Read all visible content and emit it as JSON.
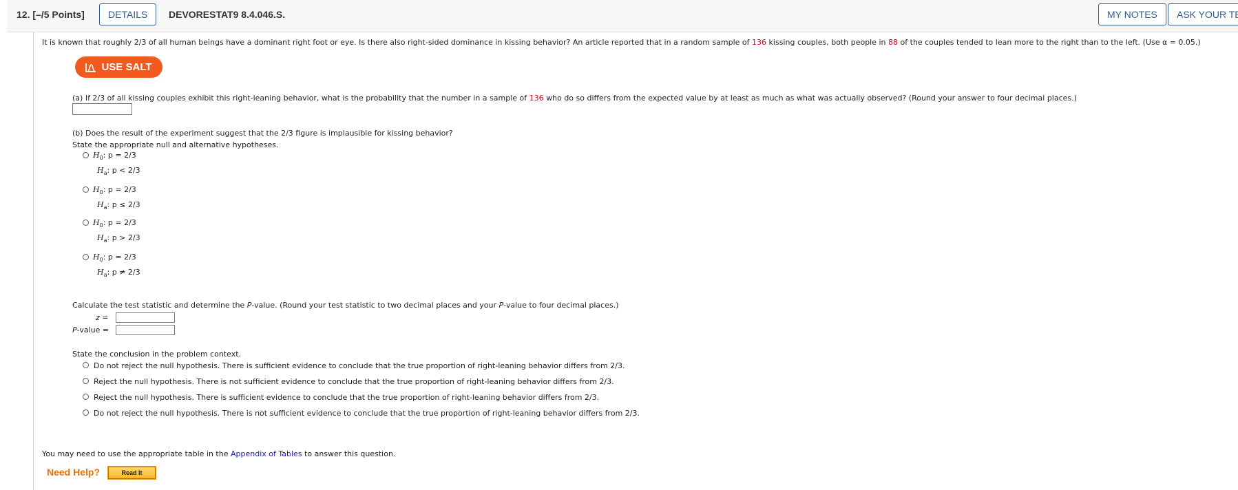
{
  "header": {
    "question_number": "12.",
    "points": "[–/5 Points]",
    "details_label": "DETAILS",
    "problem_code": "DEVORESTAT9 8.4.046.S.",
    "my_notes_label": "MY NOTES",
    "ask_teacher_label": "ASK YOUR TE"
  },
  "intro": {
    "part1": "It is known that roughly 2/3 of all human beings have a dominant right foot or eye. Is there also right-sided dominance in kissing behavior? An article reported that in a random sample of ",
    "n": "136",
    "part2": " kissing couples, both people in ",
    "x": "88",
    "part3": " of the couples tended to lean more to the right than to the left. (Use α = 0.05.)"
  },
  "salt_button": {
    "label": "USE SALT",
    "icon": "salt-chart-icon"
  },
  "part_a": {
    "part1": "(a) If 2/3 of all kissing couples exhibit this right-leaning behavior, what is the probability that the number in a sample of ",
    "n": "136",
    "part2": " who do so differs from the expected value by at least as much as what was actually observed? (Round your answer to four decimal places.)",
    "answer": ""
  },
  "part_b": {
    "question": "(b) Does the result of the experiment suggest that the 2/3 figure is implausible for kissing behavior?",
    "hypotheses_prompt": "State the appropriate null and alternative hypotheses.",
    "options": [
      {
        "h0_label": "H",
        "h0_sub": "0",
        "h0_rest": ": p = 2/3",
        "ha_label": "H",
        "ha_sub": "a",
        "ha_rest": ": p < 2/3"
      },
      {
        "h0_label": "H",
        "h0_sub": "0",
        "h0_rest": ": p = 2/3",
        "ha_label": "H",
        "ha_sub": "a",
        "ha_rest": ": p ≤ 2/3"
      },
      {
        "h0_label": "H",
        "h0_sub": "0",
        "h0_rest": ": p = 2/3",
        "ha_label": "H",
        "ha_sub": "a",
        "ha_rest": ": p > 2/3"
      },
      {
        "h0_label": "H",
        "h0_sub": "0",
        "h0_rest": ": p = 2/3",
        "ha_label": "H",
        "ha_sub": "a",
        "ha_rest": ": p ≠ 2/3"
      }
    ],
    "calc_prompt_1": "Calculate the test statistic and determine the ",
    "calc_prompt_p1": "P",
    "calc_prompt_2": "-value. (Round your test statistic to two decimal places and your ",
    "calc_prompt_p2": "P",
    "calc_prompt_3": "-value to four decimal places.)",
    "z_label": "z",
    "z_eq": " =",
    "pvalue_label": "P",
    "pvalue_rest": "-value =",
    "z_value": "",
    "p_value": "",
    "conclusion_prompt": "State the conclusion in the problem context.",
    "conclusions": [
      "Do not reject the null hypothesis. There is sufficient evidence to conclude that the true proportion of right-leaning behavior differs from 2/3.",
      "Reject the null hypothesis. There is not sufficient evidence to conclude that the true proportion of right-leaning behavior differs from 2/3.",
      "Reject the null hypothesis. There is sufficient evidence to conclude that the true proportion of right-leaning behavior differs from 2/3.",
      "Do not reject the null hypothesis. There is not sufficient evidence to conclude that the true proportion of right-leaning behavior differs from 2/3."
    ]
  },
  "footer": {
    "note_before": "You may need to use the appropriate table in the ",
    "link_text": "Appendix of Tables",
    "note_after": " to answer this question.",
    "need_help": "Need Help?",
    "read_it": "Read It"
  },
  "colors": {
    "accent_orange": "#f05a1e",
    "link_blue": "#1a1aa6",
    "highlight_red": "#d0021b",
    "button_blue": "#2e5d8e"
  }
}
